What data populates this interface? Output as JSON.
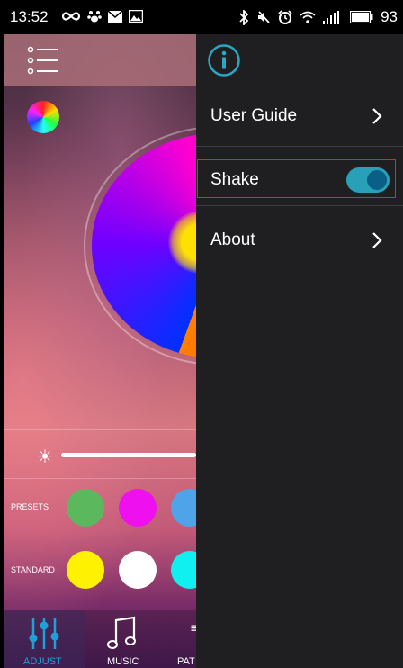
{
  "status_bar": {
    "time": "13:52",
    "left_icons": [
      "infinity-icon",
      "paw-icon",
      "mail-icon",
      "image-icon"
    ],
    "right_icons": [
      "bluetooth-icon",
      "mute-icon",
      "alarm-icon",
      "wifi-icon",
      "signal-icon",
      "battery-icon"
    ],
    "battery": "93"
  },
  "app": {
    "presets_label": "PRESETS",
    "standard_label": "STANDARD",
    "presets_colors": [
      "#5cb85c",
      "#ee10ee",
      "#4fa3e8"
    ],
    "standard_colors": [
      "#fff200",
      "#ffffff",
      "#10f0f0"
    ],
    "nav": [
      {
        "label": "ADJUST",
        "icon": "sliders-icon",
        "active": true
      },
      {
        "label": "MUSIC",
        "icon": "music-note-icon",
        "active": false
      },
      {
        "label": "PAT",
        "icon": "pattern-icon",
        "active": false
      }
    ]
  },
  "drawer": {
    "header_icon": "info-icon",
    "items": [
      {
        "label": "User Guide",
        "type": "link"
      },
      {
        "label": "Shake",
        "type": "toggle",
        "on": true
      },
      {
        "label": "About",
        "type": "link"
      }
    ]
  },
  "colors": {
    "accent": "#28a0b8",
    "highlight": "#e0262c",
    "drawer_bg": "#1f1f22"
  }
}
